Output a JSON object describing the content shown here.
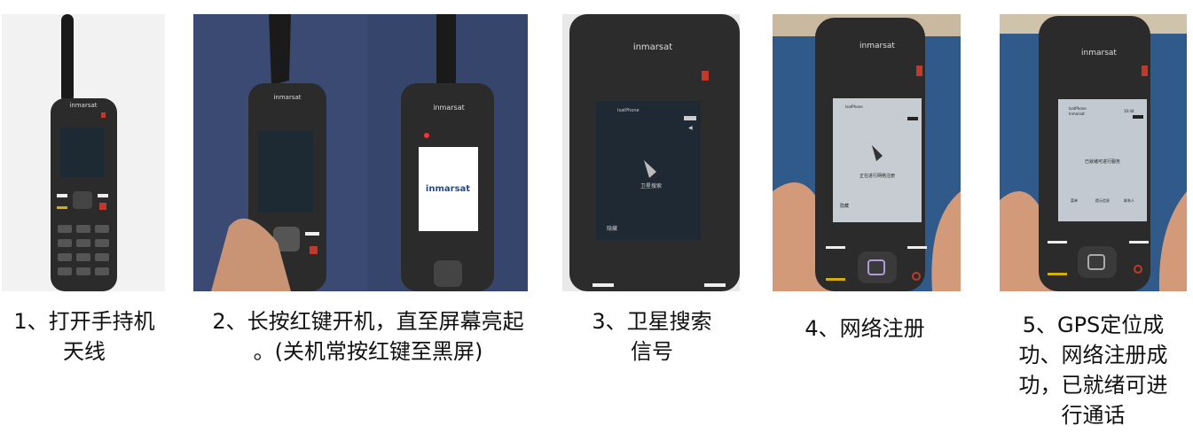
{
  "steps": [
    {
      "caption": [
        "1、打开手持机",
        "天线"
      ]
    },
    {
      "caption": [
        "2、长按红键开机，直至屏幕亮起",
        "。(关机常按红键至黑屏)"
      ]
    },
    {
      "caption": [
        "3、卫星搜索",
        "信号"
      ]
    },
    {
      "caption": [
        "4、网络注册"
      ]
    },
    {
      "caption": [
        "5、GPS定位成",
        "功、网络注册成",
        "功，已就绪可进",
        "行通话"
      ]
    }
  ],
  "brand": "inmarsat",
  "screens": {
    "step2_boot_logo": "inmarsat",
    "step3_status": "IsatPhone",
    "step3_message": "卫星搜索",
    "step3_softkey": "隐藏",
    "step4_status": "IsatPhone",
    "step4_message": "正在进行网络注册",
    "step4_softkey": "隐藏",
    "step5_status_line1": "IsatPhone",
    "step5_status_line2": "Inmarsat",
    "step5_time": "10:44",
    "step5_message": "已就绪可进行服务",
    "step5_softkeys": [
      "菜单",
      "提示信息",
      "联系人"
    ]
  },
  "colors": {
    "phone_body": "#2b2b2b",
    "red_key": "#c0392b",
    "carpet_blue": "#3b4a72",
    "screen_idle": "#1e2a33",
    "screen_active": "#bfc7cf"
  }
}
